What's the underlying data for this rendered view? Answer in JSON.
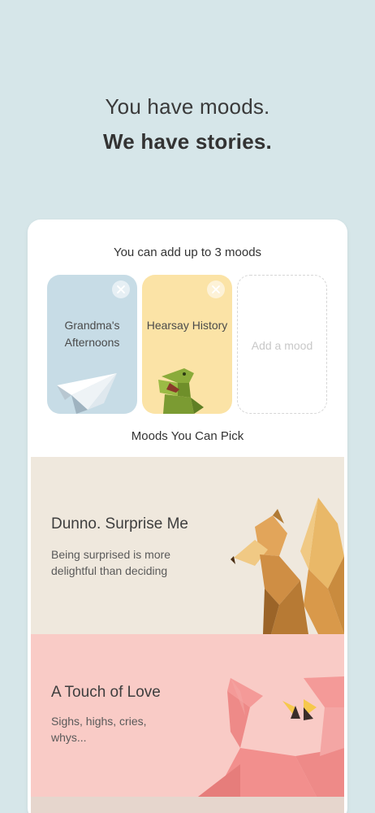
{
  "header": {
    "line1": "You have moods.",
    "line2": "We have stories."
  },
  "selection": {
    "subtitle": "You can add up to 3 moods",
    "slots": [
      {
        "label": "Grandma's Afternoons",
        "icon": "paper-plane-icon",
        "color": "#c7dce6"
      },
      {
        "label": "Hearsay History",
        "icon": "dinosaur-icon",
        "color": "#fbe3a6"
      },
      {
        "label": "Add a mood"
      }
    ]
  },
  "picker": {
    "title": "Moods You Can Pick",
    "moods": [
      {
        "title": "Dunno. Surprise Me",
        "desc": "Being surprised is more delightful than deciding",
        "icon": "squirrel-icon",
        "color": "#efe8dd"
      },
      {
        "title": "A Touch of Love",
        "desc": "Sighs, highs, cries, whys...",
        "icon": "flamingo-icon",
        "color": "#f9cbc6"
      }
    ]
  },
  "colors": {
    "background": "#d6e6e9",
    "card": "#ffffff"
  }
}
